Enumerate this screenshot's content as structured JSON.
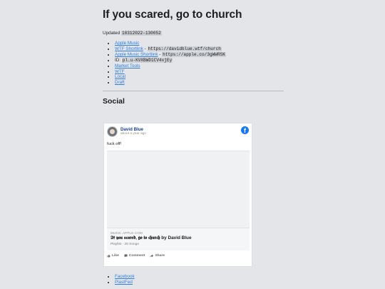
{
  "page": {
    "title": "If you scared, go to church",
    "updated_label": "Updated",
    "updated_code": "10312022-130052",
    "links": [
      {
        "text": "Apple Music"
      },
      {
        "text": "WTF Shortlink",
        "sep": "-",
        "code": "https://davidblue.wtf/church"
      },
      {
        "text": "Apple Music Shortlink",
        "sep": "-",
        "code": "https://apple.co/3gWWRSK"
      },
      {
        "label": "ID:",
        "code": "pl.u-KVXBWD1CV4xjEy"
      },
      {
        "text": "Market Tools"
      },
      {
        "text": "WTF"
      },
      {
        "text": "Local"
      },
      {
        "text": "Draft"
      }
    ],
    "social_heading": "Social"
  },
  "fb_card": {
    "author": "David Blue",
    "time": "about a year ago",
    "post_text": "fuck off!",
    "logo_letter": "f",
    "preview_domain": "MUSIC.APPLE.COM",
    "preview_title_fancy": "𝕴𝖋 𝖞𝖔𝖚 𝖘𝖈𝖆𝖗𝖊𝖉, 𝖌𝖔 𝖙𝖔 𝖈𝖍𝖚𝖗𝖈𝖍",
    "preview_title_rest": " by David Blue",
    "preview_desc": "Playlist · 28 Songs",
    "actions": {
      "like": "Like",
      "comment": "Comment",
      "share": "Share"
    }
  },
  "bottom_links": [
    {
      "text": "Facebook"
    },
    {
      "text": "PlastFed"
    }
  ],
  "colors": {
    "link": "#2f7de0",
    "background": "#e3e5e8",
    "facebook": "#1877f2"
  }
}
